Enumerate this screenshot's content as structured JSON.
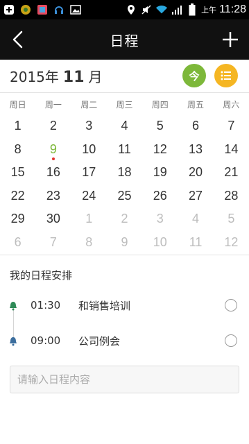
{
  "status_bar": {
    "ampm": "上午",
    "time": "11:28"
  },
  "appbar": {
    "title": "日程"
  },
  "month": {
    "year_label": "2015年",
    "month_number": "11",
    "month_suffix": "月",
    "today_button": "今"
  },
  "calendar": {
    "weekdays": [
      "周日",
      "周一",
      "周二",
      "周三",
      "周四",
      "周五",
      "周六"
    ],
    "days": [
      {
        "d": "1"
      },
      {
        "d": "2"
      },
      {
        "d": "3"
      },
      {
        "d": "4"
      },
      {
        "d": "5"
      },
      {
        "d": "6"
      },
      {
        "d": "7"
      },
      {
        "d": "8"
      },
      {
        "d": "9",
        "today": true,
        "has_event": true
      },
      {
        "d": "10"
      },
      {
        "d": "11"
      },
      {
        "d": "12"
      },
      {
        "d": "13"
      },
      {
        "d": "14"
      },
      {
        "d": "15"
      },
      {
        "d": "16"
      },
      {
        "d": "17"
      },
      {
        "d": "18"
      },
      {
        "d": "19"
      },
      {
        "d": "20"
      },
      {
        "d": "21"
      },
      {
        "d": "22"
      },
      {
        "d": "23"
      },
      {
        "d": "24"
      },
      {
        "d": "25"
      },
      {
        "d": "26"
      },
      {
        "d": "27"
      },
      {
        "d": "28"
      },
      {
        "d": "29"
      },
      {
        "d": "30"
      },
      {
        "d": "1",
        "other": true
      },
      {
        "d": "2",
        "other": true
      },
      {
        "d": "3",
        "other": true
      },
      {
        "d": "4",
        "other": true
      },
      {
        "d": "5",
        "other": true
      },
      {
        "d": "6",
        "other": true
      },
      {
        "d": "7",
        "other": true
      },
      {
        "d": "8",
        "other": true
      },
      {
        "d": "9",
        "other": true
      },
      {
        "d": "10",
        "other": true
      },
      {
        "d": "11",
        "other": true
      },
      {
        "d": "12",
        "other": true
      }
    ]
  },
  "schedule": {
    "title": "我的日程安排",
    "items": [
      {
        "time": "01:30",
        "text": "和销售培训"
      },
      {
        "time": "09:00",
        "text": "公司例会"
      }
    ],
    "input_placeholder": "请输入日程内容"
  },
  "colors": {
    "accent_green": "#7db83a",
    "accent_orange": "#f5b623",
    "event_dot": "#e3342f",
    "bell_first": "#2e8b57",
    "bell_second": "#3c6e9e"
  }
}
